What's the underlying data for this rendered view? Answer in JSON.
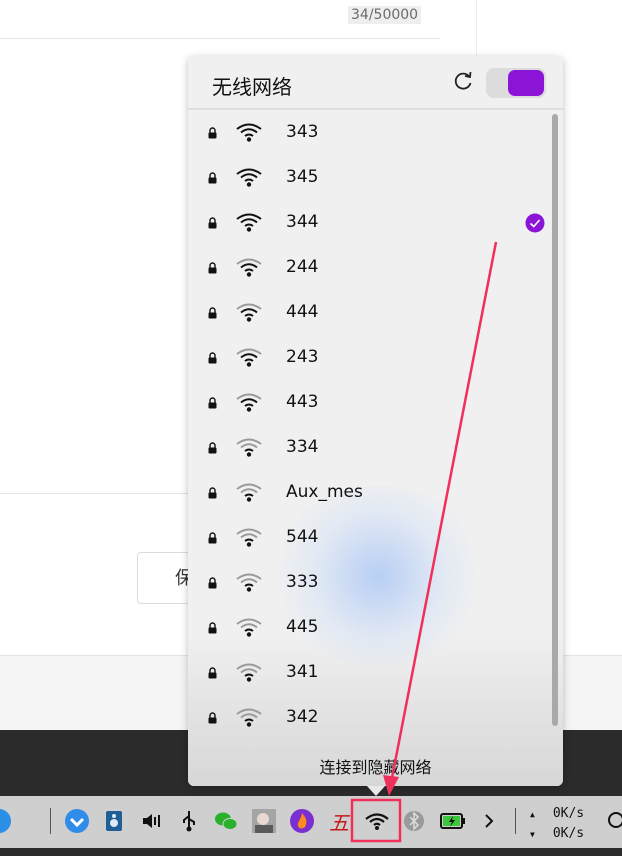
{
  "background": {
    "counter": "34/50000",
    "save_label": "保"
  },
  "wifi_panel": {
    "title": "无线网络",
    "enabled": true,
    "accent": "#8b14d6",
    "networks": [
      {
        "ssid": "343",
        "secured": true,
        "signal": "strong",
        "connected": false
      },
      {
        "ssid": "345",
        "secured": true,
        "signal": "strong",
        "connected": false
      },
      {
        "ssid": "344",
        "secured": true,
        "signal": "strong",
        "connected": true
      },
      {
        "ssid": "244",
        "secured": true,
        "signal": "medium",
        "connected": false
      },
      {
        "ssid": "444",
        "secured": true,
        "signal": "medium",
        "connected": false
      },
      {
        "ssid": "243",
        "secured": true,
        "signal": "medium",
        "connected": false
      },
      {
        "ssid": "443",
        "secured": true,
        "signal": "medium",
        "connected": false
      },
      {
        "ssid": "334",
        "secured": true,
        "signal": "weak",
        "connected": false
      },
      {
        "ssid": "Aux_mes",
        "secured": true,
        "signal": "weak",
        "connected": false
      },
      {
        "ssid": "544",
        "secured": true,
        "signal": "weak",
        "connected": false
      },
      {
        "ssid": "333",
        "secured": true,
        "signal": "weak",
        "connected": false
      },
      {
        "ssid": "445",
        "secured": true,
        "signal": "weak",
        "connected": false
      },
      {
        "ssid": "341",
        "secured": true,
        "signal": "weak",
        "connected": false
      },
      {
        "ssid": "342",
        "secured": true,
        "signal": "weak",
        "connected": false
      }
    ],
    "hidden_network_label": "连接到隐藏网络"
  },
  "taskbar": {
    "tray_icons": [
      "launcher-icon",
      "dde-file-icon",
      "volume-icon",
      "usb-icon",
      "wechat-icon",
      "app-avatar-icon",
      "fire-app-icon",
      "wubi-input-icon",
      "wifi-icon",
      "bluetooth-icon",
      "battery-icon",
      "expand-chevron-icon"
    ],
    "ime_label": "五",
    "upload_speed": "0K/s",
    "download_speed": "0K/s"
  },
  "annotation": {
    "color": "#f0305a"
  }
}
